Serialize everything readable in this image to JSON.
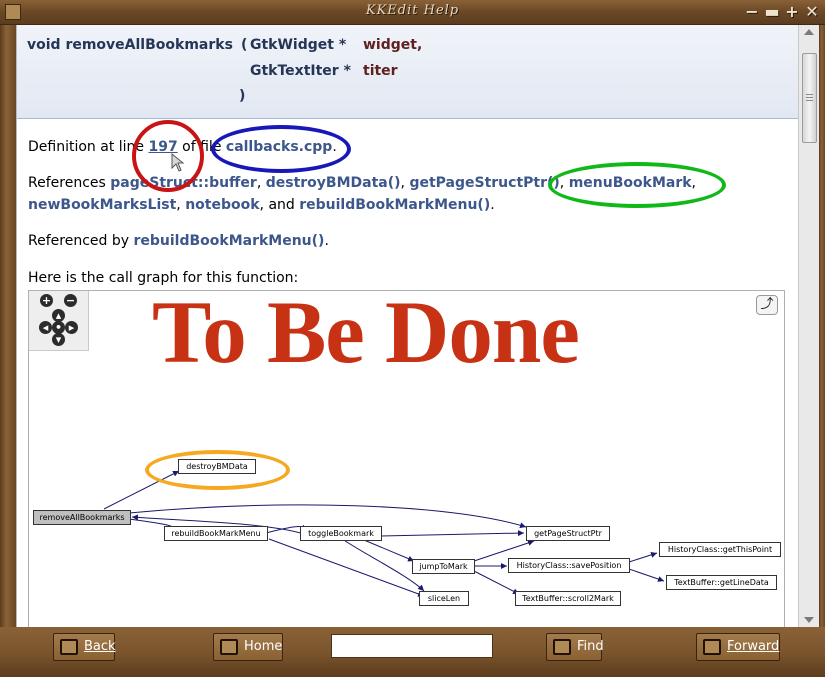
{
  "window": {
    "title": "KKEdit Help",
    "controls": [
      "−",
      "▬",
      "+",
      "✕"
    ]
  },
  "proto": {
    "ret_name": "void removeAllBookmarks",
    "paren_open": "(",
    "type1": "GtkWidget *",
    "param1": "widget,",
    "type2": "GtkTextIter *",
    "param2": "titer",
    "paren_close": ")"
  },
  "definition": {
    "prefix": "Definition at line",
    "line": "197",
    "middle": "of file",
    "file": "callbacks.cpp",
    "suffix": "."
  },
  "references": {
    "prefix": "References",
    "items": [
      "pageStruct::buffer",
      "destroyBMData()",
      "getPageStructPtr()",
      "menuBookMark",
      "newBookMarksList",
      "notebook",
      "rebuildBookMarkMenu()"
    ],
    "and": "and",
    "end": "."
  },
  "referenced_by": {
    "prefix": "Referenced by",
    "item": "rebuildBookMarkMenu()",
    "end": "."
  },
  "callgraph_intro": "Here is the call graph for this function:",
  "overlay_text": "To Be Done",
  "graph": {
    "nodes": {
      "root": "removeAllBookmarks",
      "destroy": "destroyBMData",
      "rebuild": "rebuildBookMarkMenu",
      "toggle": "toggleBookmark",
      "getpage": "getPageStructPtr",
      "jump": "jumpToMark",
      "slice": "sliceLen",
      "save": "HistoryClass::savePosition",
      "scroll": "TextBuffer::scroll2Mark",
      "getthis": "HistoryClass::getThisPoint",
      "getline": "TextBuffer::getLineData"
    },
    "zoom_in": "+",
    "zoom_out": "−",
    "fullscreen_icon": "⤴"
  },
  "toolbar": {
    "back": "Back",
    "home": "Home",
    "find": "Find",
    "forward": "Forward",
    "search_value": ""
  },
  "annotations": {
    "red": "#c81414",
    "blue": "#1818b8",
    "green": "#10b818",
    "orange": "#f5a820"
  }
}
